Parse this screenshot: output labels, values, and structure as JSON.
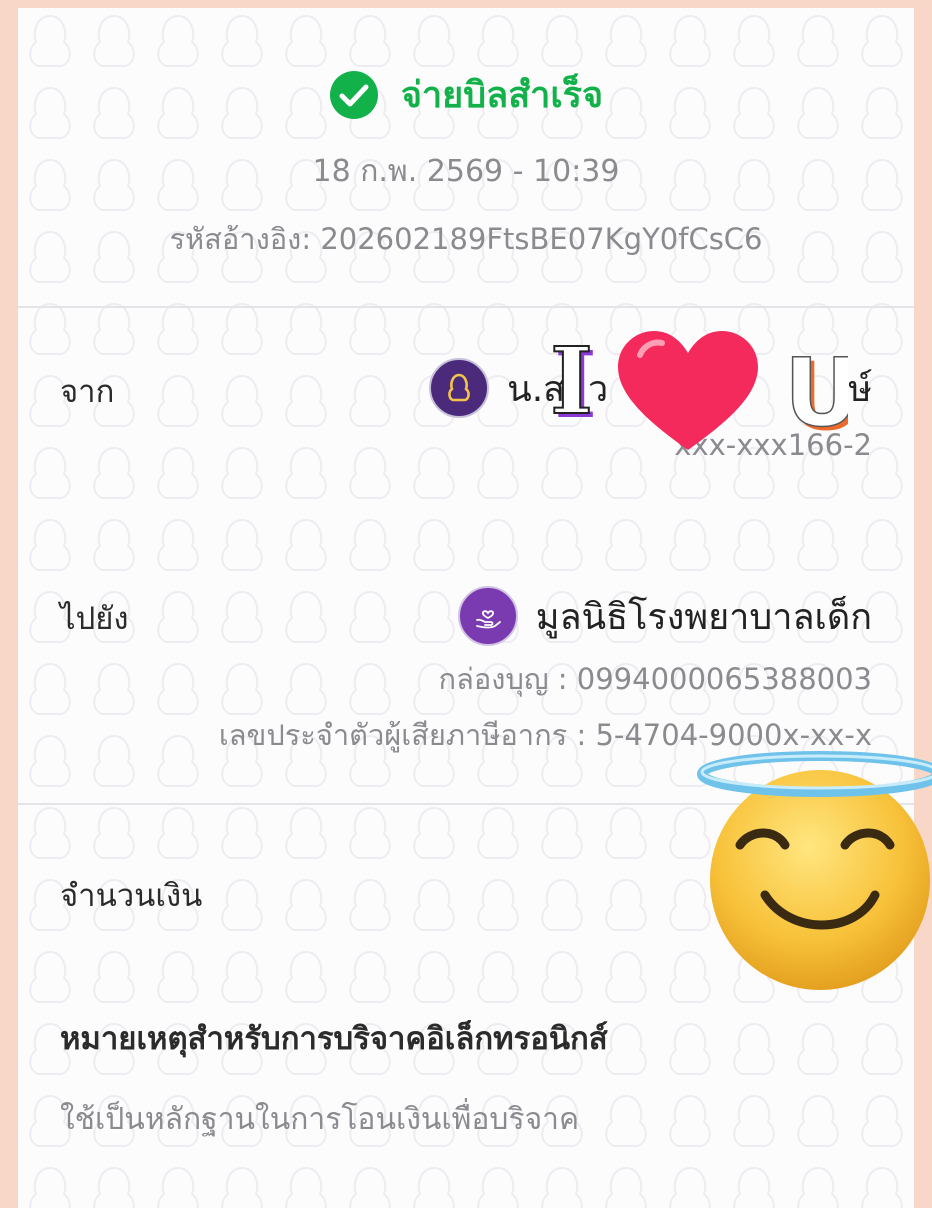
{
  "status": {
    "title": "จ่ายบิลสำเร็จ",
    "color": "#12b14a",
    "icon": "check-circle-icon"
  },
  "datetime": "18 ก.พ. 2569 - 10:39",
  "reference": {
    "label": "รหัสอ้างอิง:",
    "value": "202602189FtsBE07KgY0fCsC6"
  },
  "from": {
    "label": "จาก",
    "name": "น.ส. ว",
    "name_end": "ษ์",
    "account": "xxx-xxx166-2",
    "icon": "bank-logo-icon"
  },
  "to": {
    "label": "ไปยัง",
    "name": "มูลนิธิโรงพยาบาลเด็ก",
    "box_label": "กล่องบุญ :",
    "box_value": "0994000065388003",
    "tax_label": "เลขประจำตัวผู้เสียภาษีอากร :",
    "tax_value": "5-4704-9000x-xx-x",
    "icon": "charity-hand-heart-icon"
  },
  "amount": {
    "label": "จำนวนเงิน"
  },
  "note": {
    "title": "หมายเหตุสำหรับการบริจาคอิเล็กทรอนิกส์",
    "text": "ใช้เป็นหลักฐานในการโอนเงินเพื่อบริจาค"
  },
  "sticker": {
    "i": "I",
    "u": "U"
  }
}
